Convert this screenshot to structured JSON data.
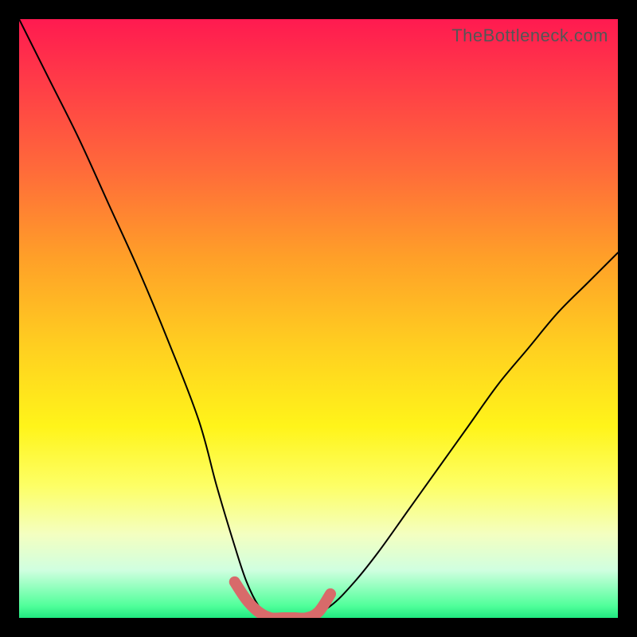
{
  "watermark": "TheBottleneck.com",
  "chart_data": {
    "type": "line",
    "title": "",
    "xlabel": "",
    "ylabel": "",
    "xlim": [
      0,
      100
    ],
    "ylim": [
      0,
      100
    ],
    "series": [
      {
        "name": "bottleneck-curve",
        "x": [
          0,
          5,
          10,
          15,
          20,
          25,
          30,
          33,
          36,
          38,
          40,
          42,
          44,
          48,
          52,
          56,
          60,
          65,
          70,
          75,
          80,
          85,
          90,
          95,
          100
        ],
        "values": [
          100,
          90,
          80,
          69,
          58,
          46,
          33,
          22,
          12,
          6,
          2,
          0,
          0,
          0,
          2,
          6,
          11,
          18,
          25,
          32,
          39,
          45,
          51,
          56,
          61
        ]
      },
      {
        "name": "highlight-band",
        "x": [
          36,
          38,
          40,
          42,
          44,
          46,
          48,
          50,
          52
        ],
        "values": [
          6,
          3,
          1,
          0,
          0,
          0,
          0,
          1,
          4
        ]
      }
    ],
    "colors": {
      "curve": "#000000",
      "highlight": "#d86a6a"
    }
  }
}
